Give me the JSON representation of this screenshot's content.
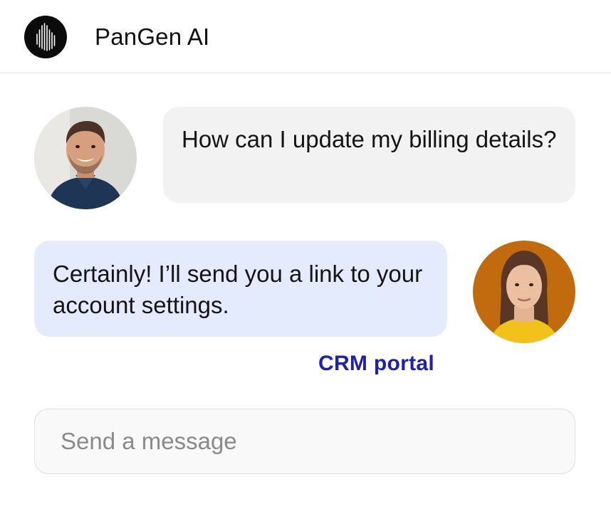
{
  "header": {
    "logo_icon": "pangen-logo-icon",
    "title": "PanGen AI"
  },
  "conversation": {
    "messages": [
      {
        "sender": "user",
        "avatar_icon": "user-avatar-man",
        "text": "How can I update my billing details?"
      },
      {
        "sender": "assistant",
        "avatar_icon": "assistant-avatar-woman",
        "text": "Certainly! I’ll send you a link to your account settings.",
        "link_label": "CRM portal"
      }
    ]
  },
  "composer": {
    "placeholder": "Send a message",
    "value": ""
  },
  "colors": {
    "user_bubble": "#f2f2f2",
    "assistant_bubble": "#e4ebfd",
    "link": "#2020b0",
    "logo_bg": "#0b0b0b"
  }
}
